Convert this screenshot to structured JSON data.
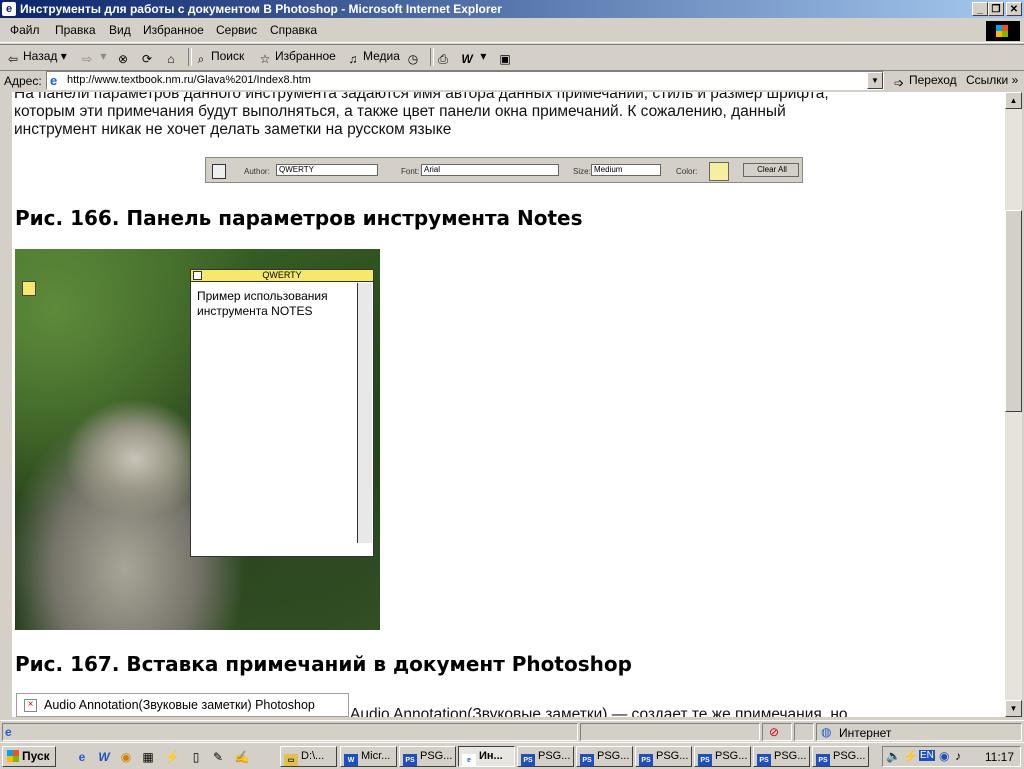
{
  "window": {
    "title": "Инструменты для работы с документом В Photoshop - Microsoft Internet Explorer"
  },
  "menubar": [
    "Файл",
    "Правка",
    "Вид",
    "Избранное",
    "Сервис",
    "Справка"
  ],
  "toolbar": {
    "back": "Назад",
    "search": "Поиск",
    "favorites": "Избранное",
    "media": "Медиа"
  },
  "address": {
    "label": "Адрес:",
    "url": "http://www.textbook.nm.ru/Glava%201/Index8.htm",
    "go": "Переход",
    "links": "Ссылки"
  },
  "content": {
    "para_line1": "На панели параметров данного инструмента задаются имя автора данных примечаний, стиль и размер шрифта,",
    "para_line2": "которым эти примечания будут выполняться, а также цвет панели окна примечаний. К сожалению, данный",
    "para_line3": "инструмент никак не хочет делать заметки на русском языке",
    "options_bar": {
      "author_label": "Author:",
      "author_value": "QWERTY",
      "font_label": "Font:",
      "font_value": "Arial",
      "size_label": "Size:",
      "size_value": "Medium",
      "color_label": "Color:",
      "note_color": "#f5f0a0",
      "clear_all": "Clear All"
    },
    "caption_166": "Рис. 166. Панель параметров инструмента Notes",
    "note": {
      "author": "QWERTY",
      "text": "Пример использования инструмента NOTES",
      "color": "#f5e86a"
    },
    "caption_167": "Рис. 167. Вставка примечаний в документ Photoshop",
    "broken_image_alt": "Audio Annotation(Звуковые заметки) Photoshop",
    "cut_text": "Audio Annotation(Звуковые заметки) — создает те же примечания, но"
  },
  "statusbar": {
    "zone": "Интернет"
  },
  "taskbar": {
    "start": "Пуск",
    "tasks": [
      "D:\\...",
      "Micr...",
      "PSG...",
      "Ин...",
      "PSG...",
      "PSG...",
      "PSG...",
      "PSG...",
      "PSG...",
      "PSG..."
    ],
    "lang": "EN",
    "clock": "11:17"
  },
  "colors": {
    "titlebar_start": "#0a246a",
    "titlebar_end": "#a6caf0",
    "chrome": "#d4d0c8"
  }
}
